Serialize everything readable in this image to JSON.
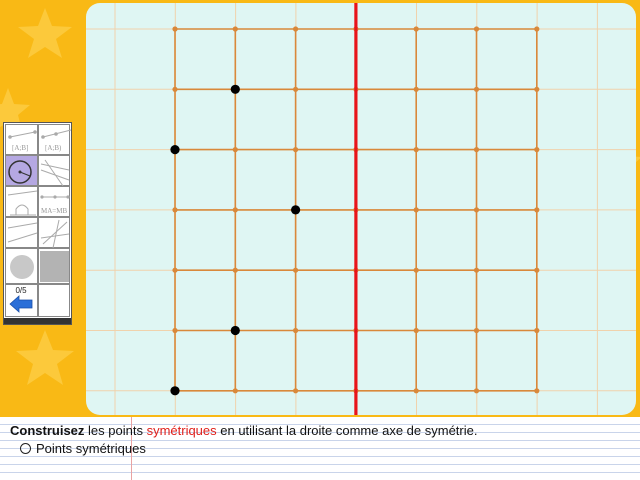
{
  "instruction": {
    "bold": "Construisez",
    "part1": " les points ",
    "highlight": "symétriques",
    "part2": " en utilisant la droite comme axe de symétrie."
  },
  "option_label": "Points symétriques",
  "score": "0/5",
  "tools": [
    {
      "name": "segment-tool",
      "label": "[A;B]"
    },
    {
      "name": "ray-tool",
      "label": "[A;B)"
    },
    {
      "name": "compass-tool",
      "label": ""
    },
    {
      "name": "lines-tool",
      "label": ""
    },
    {
      "name": "protractor-tool",
      "label": ""
    },
    {
      "name": "equal-distance-tool",
      "label": "MA=MB"
    },
    {
      "name": "parallel-tool",
      "label": ""
    },
    {
      "name": "perpendicular-tool",
      "label": ""
    },
    {
      "name": "disc-tool",
      "label": ""
    },
    {
      "name": "fill-tool",
      "label": ""
    },
    {
      "name": "undo-tool",
      "label": ""
    },
    {
      "name": "empty-tool",
      "label": ""
    }
  ],
  "grid": {
    "columns": 6,
    "rows": 6,
    "color": "#d9883a",
    "axis_color": "#e8141a",
    "point_color": "#000000"
  },
  "given_points": [
    {
      "col": 1,
      "row": 1
    },
    {
      "col": 0,
      "row": 2
    },
    {
      "col": 2,
      "row": 3
    },
    {
      "col": 1,
      "row": 5
    },
    {
      "col": 0,
      "row": 6
    }
  ],
  "symmetry_axis_col": 3
}
